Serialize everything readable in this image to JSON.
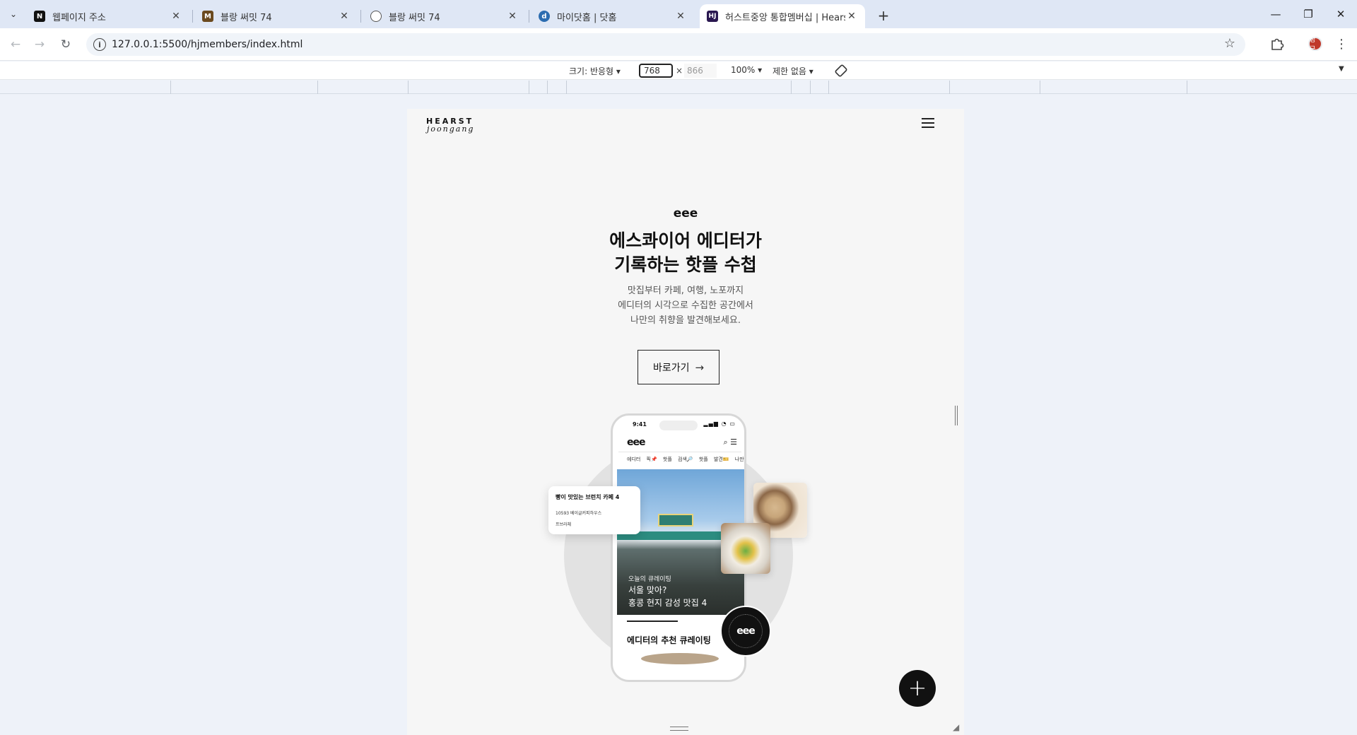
{
  "browser": {
    "tabs": [
      {
        "title": "웹페이지 주소",
        "favicon": "N",
        "favicon_color": "#111111",
        "active": false
      },
      {
        "title": "블랑 써밋 74",
        "favicon": "M",
        "favicon_color": "#6b4a1f",
        "active": false
      },
      {
        "title": "블랑 써밋 74",
        "favicon": "globe",
        "favicon_color": "#555555",
        "active": false
      },
      {
        "title": "마이닷홈 | 닷홈",
        "favicon": "d",
        "favicon_color": "#2b6cb0",
        "active": false
      },
      {
        "title": "허스트중앙 통합멤버십 | Hearst",
        "favicon": "HJ",
        "favicon_color": "#2a1850",
        "active": true
      }
    ],
    "url": "127.0.0.1:5500/hjmembers/index.html",
    "profile_initials": "정근",
    "profile_color": "#c0392b"
  },
  "devtools": {
    "size_label": "크기: 반응형 ▾",
    "width": "768",
    "x_sep": "×",
    "height": "866",
    "zoom": "100% ▾",
    "throttle": "제한 없음 ▾"
  },
  "page": {
    "logo_line1": "HEARST",
    "logo_line2": "joongang",
    "brand": "eee",
    "title_line1": "에스콰이어 에디터가",
    "title_line2": "기록하는 핫플 수첩",
    "desc_line1": "맛집부터 카페, 여행, 노포까지",
    "desc_line2": "에디터의 시각으로 수집한 공간에서",
    "desc_line3": "나만의 취향을 발견해보세요.",
    "cta_label": "바로가기",
    "phone": {
      "time": "9:41",
      "logo": "eee",
      "categories": "에디터 픽📌 핫플 검색🔎 핫플 발견🎫 나만의",
      "hero_sub": "오늘의 큐레이팅",
      "hero_title_line1": "서울 맞아?",
      "hero_title_line2": "홍콩 현지 감성 맛집 4",
      "section_title": "에디터의 추천 큐레이팅"
    },
    "float_card": {
      "title": "빵이 맛있는 브런치 카페 4",
      "line1": "10593 베이글커피하우스",
      "line2": "프브라체"
    },
    "badge_text": "eee",
    "fab_label": "+"
  }
}
